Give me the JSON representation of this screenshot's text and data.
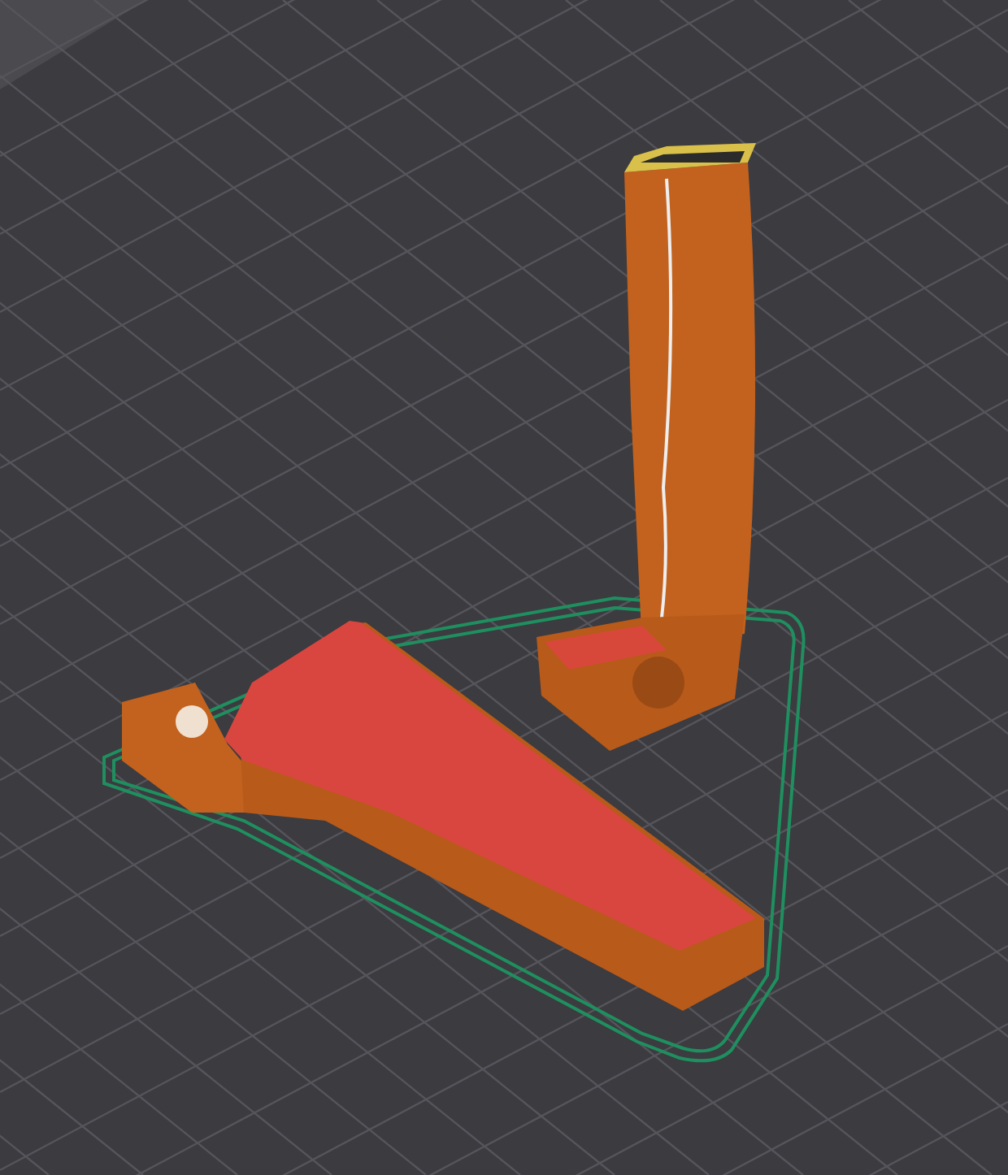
{
  "viewport": {
    "skirt": true
  }
}
